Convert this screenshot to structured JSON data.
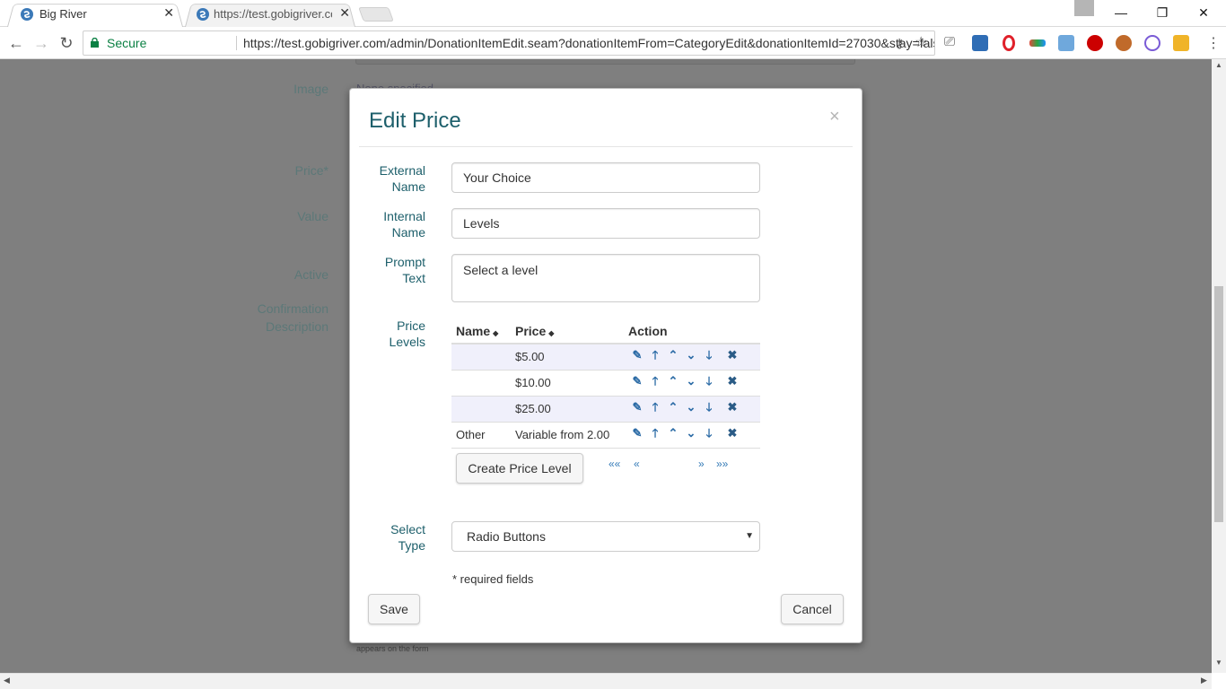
{
  "browser": {
    "tabs": [
      {
        "title": "Big River",
        "active": true
      },
      {
        "title": "https://test.gobigriver.co",
        "active": false
      }
    ],
    "secure_label": "Secure",
    "url": "https://test.gobigriver.com/admin/DonationItemEdit.seam?donationItemFrom=CategoryEdit&donationItemId=27030&stay=false&",
    "window_controls": {
      "minimize": "—",
      "restore": "❐",
      "close": "✕"
    }
  },
  "background_form": {
    "labels": [
      "Image",
      "Price*",
      "Value",
      "Active",
      "Confirmation",
      "Description"
    ],
    "image_value": "None specified",
    "footnote": "appears on the form"
  },
  "modal": {
    "title": "Edit Price",
    "close": "×",
    "fields": {
      "external_name": {
        "label1": "External",
        "label2": "Name",
        "value": "Your Choice"
      },
      "internal_name": {
        "label1": "Internal",
        "label2": "Name",
        "value": "Levels"
      },
      "prompt_text": {
        "label1": "Prompt",
        "label2": "Text",
        "value": "Select a level"
      },
      "price_levels": {
        "label1": "Price",
        "label2": "Levels"
      },
      "select_type": {
        "label1": "Select",
        "label2": "Type",
        "value": "Radio Buttons"
      }
    },
    "table": {
      "headers": {
        "name": "Name",
        "price": "Price",
        "action": "Action"
      },
      "rows": [
        {
          "name": "",
          "price": "$5.00"
        },
        {
          "name": "",
          "price": "$10.00"
        },
        {
          "name": "",
          "price": "$25.00"
        },
        {
          "name": "Other",
          "price": "Variable from 2.00"
        }
      ]
    },
    "create_button": "Create Price Level",
    "pager": {
      "first": "««",
      "prev": "«",
      "next": "»",
      "last": "»»"
    },
    "required_note": "* required fields",
    "save": "Save",
    "cancel": "Cancel"
  },
  "colors": {
    "accent": "#1d5f6b",
    "link": "#337ab7",
    "overlay": "#7f7f7f"
  }
}
